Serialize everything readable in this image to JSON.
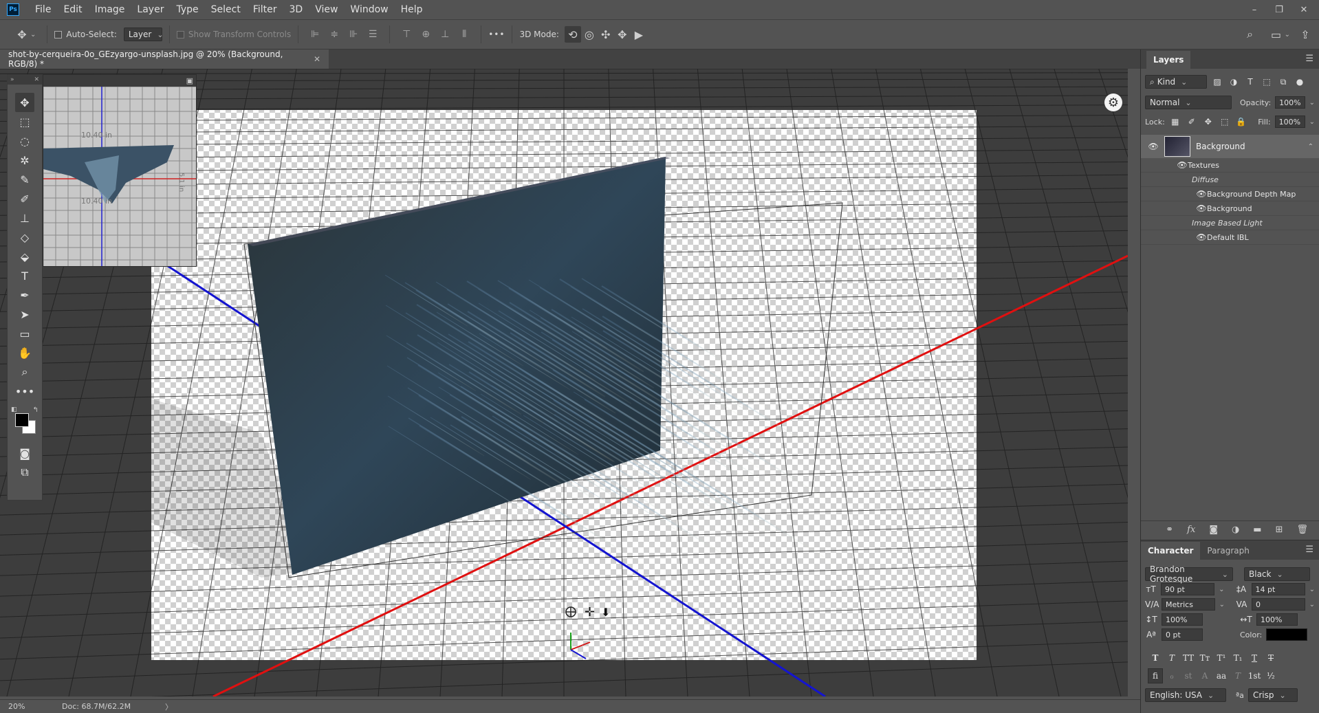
{
  "app": {
    "logo": "Ps"
  },
  "menu": [
    "File",
    "Edit",
    "Image",
    "Layer",
    "Type",
    "Select",
    "Filter",
    "3D",
    "View",
    "Window",
    "Help"
  ],
  "window_controls": {
    "minimize": "–",
    "restore": "❐",
    "close": "✕"
  },
  "options": {
    "auto_select_label": "Auto-Select:",
    "auto_select_target": "Layer",
    "show_transform_label": "Show Transform Controls",
    "mode_label": "3D Mode:",
    "more": "•••"
  },
  "document": {
    "tab_title": "shot-by-cerqueira-0o_GEzyargo-unsplash.jpg @ 20% (Background, RGB/8) *",
    "close": "✕"
  },
  "navigator": {
    "label_top": "10.40 in",
    "label_bottom": "10.40 in",
    "label_right": "5.1 in"
  },
  "status": {
    "zoom": "20%",
    "doc": "Doc: 68.7M/62.2M",
    "arrow": "〉"
  },
  "layers": {
    "tab": "Layers",
    "filter_kind": "Kind",
    "blend_mode": "Normal",
    "opacity_label": "Opacity:",
    "opacity_value": "100%",
    "lock_label": "Lock:",
    "fill_label": "Fill:",
    "fill_value": "100%",
    "layer_name": "Background",
    "textures": "Textures",
    "diffuse": "Diffuse",
    "depth_map": "Background Depth Map",
    "background_texture": "Background",
    "ibl_group": "Image Based Light",
    "default_ibl": "Default IBL"
  },
  "character": {
    "tab_character": "Character",
    "tab_paragraph": "Paragraph",
    "font_family": "Brandon Grotesque",
    "font_style": "Black",
    "font_size": "90 pt",
    "leading": "14 pt",
    "kerning": "Metrics",
    "tracking": "0",
    "vscale": "100%",
    "hscale": "100%",
    "baseline": "0 pt",
    "color_label": "Color:",
    "style_buttons": [
      "T",
      "T",
      "TT",
      "Tт",
      "T¹",
      "T₁",
      "T",
      "T"
    ],
    "ot_buttons": [
      "fi",
      "ℴ",
      "st",
      "A",
      "aa",
      "T",
      "1st",
      "½"
    ],
    "language": "English: USA",
    "aa_label": "ªa",
    "antialias": "Crisp"
  }
}
